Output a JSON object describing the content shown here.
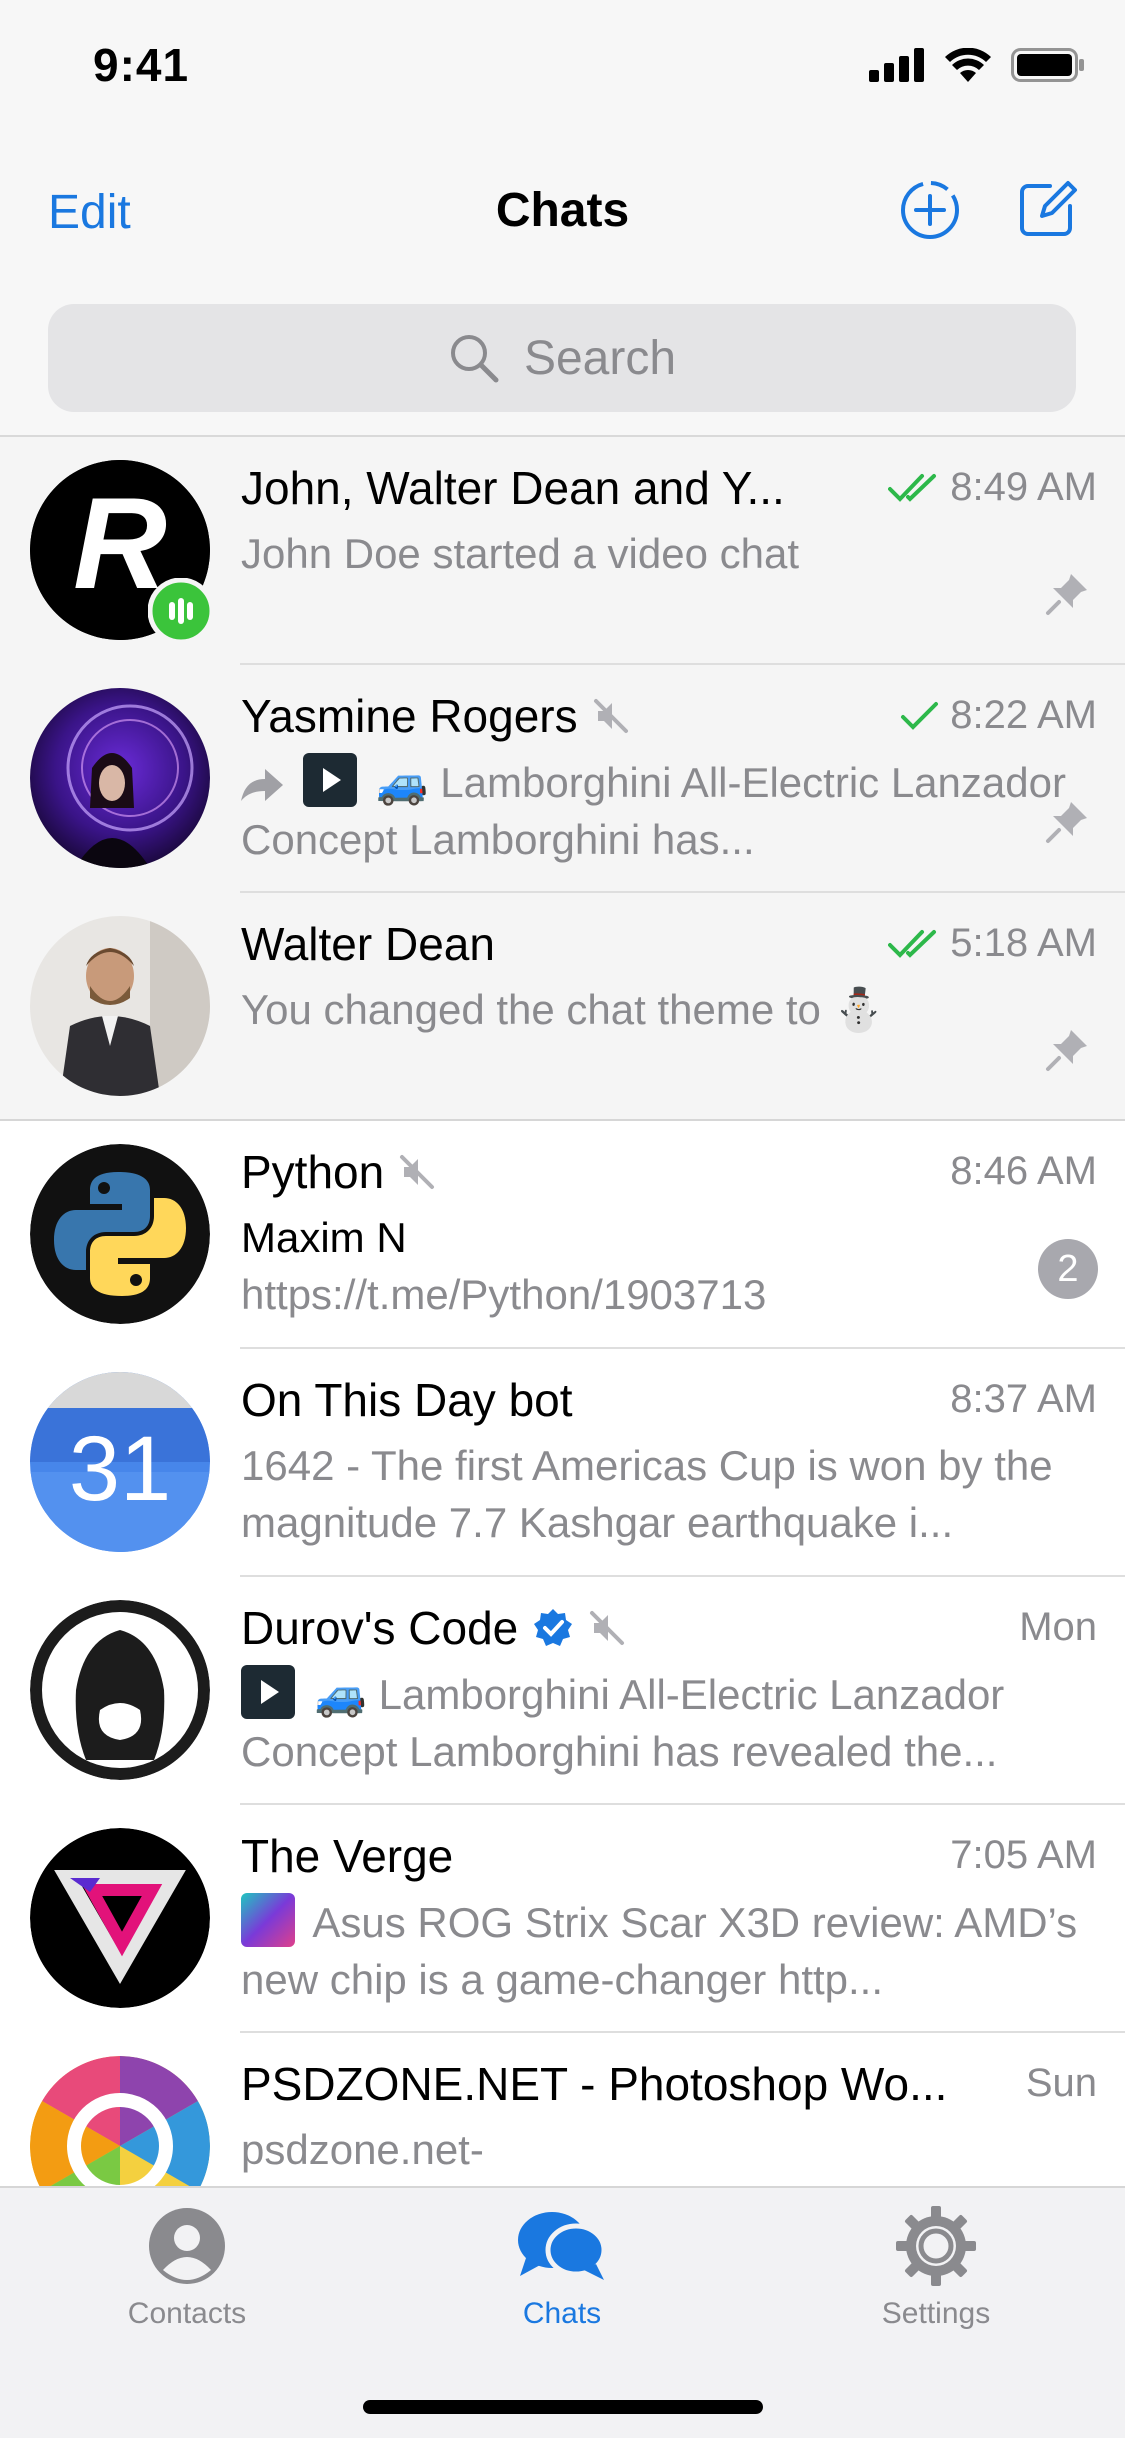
{
  "status": {
    "time": "9:41"
  },
  "nav": {
    "edit_label": "Edit",
    "title": "Chats"
  },
  "search": {
    "placeholder": "Search"
  },
  "chats": [
    {
      "name": "John, Walter Dean and Y...",
      "time": "8:49 AM",
      "preview": "John Doe started a video chat",
      "pinned": true,
      "read": "double"
    },
    {
      "name": "Yasmine Rogers",
      "time": "8:22 AM",
      "preview": "🚙 Lamborghini All-Electric Lanzador Concept Lamborghini has...",
      "pinned": true,
      "muted": true,
      "read": "single"
    },
    {
      "name": "Walter Dean",
      "time": "5:18 AM",
      "preview": "You changed the chat theme to ⛄",
      "pinned": true,
      "read": "double"
    },
    {
      "name": "Python",
      "time": "8:46 AM",
      "sender": "Maxim N",
      "preview": "https://t.me/Python/1903713",
      "muted": true,
      "badge": "2"
    },
    {
      "name": "On This Day bot",
      "time": "8:37 AM",
      "preview": "1642 - The first Americas Cup is won by the magnitude 7.7 Kashgar earthquake i...",
      "avatar_text": "31"
    },
    {
      "name": "Durov's Code",
      "time": "Mon",
      "preview": "🚙 Lamborghini All-Electric Lanzador Concept Lamborghini has revealed the...",
      "verified": true,
      "muted": true
    },
    {
      "name": "The Verge",
      "time": "7:05 AM",
      "preview": "Asus ROG Strix Scar X3D review: AMD’s new chip is a game-changer http..."
    },
    {
      "name": "PSDZONE.NET - Photoshop Wo...",
      "time": "Sun",
      "preview": "psdzone.net-"
    }
  ],
  "tabs": [
    {
      "label": "Contacts",
      "icon": "person-icon"
    },
    {
      "label": "Chats",
      "icon": "chat-bubbles-icon",
      "active": true
    },
    {
      "label": "Settings",
      "icon": "gear-icon"
    }
  ],
  "colors": {
    "accent": "#1a78e0",
    "read_check": "#2db84a",
    "online": "#3bc43b"
  }
}
